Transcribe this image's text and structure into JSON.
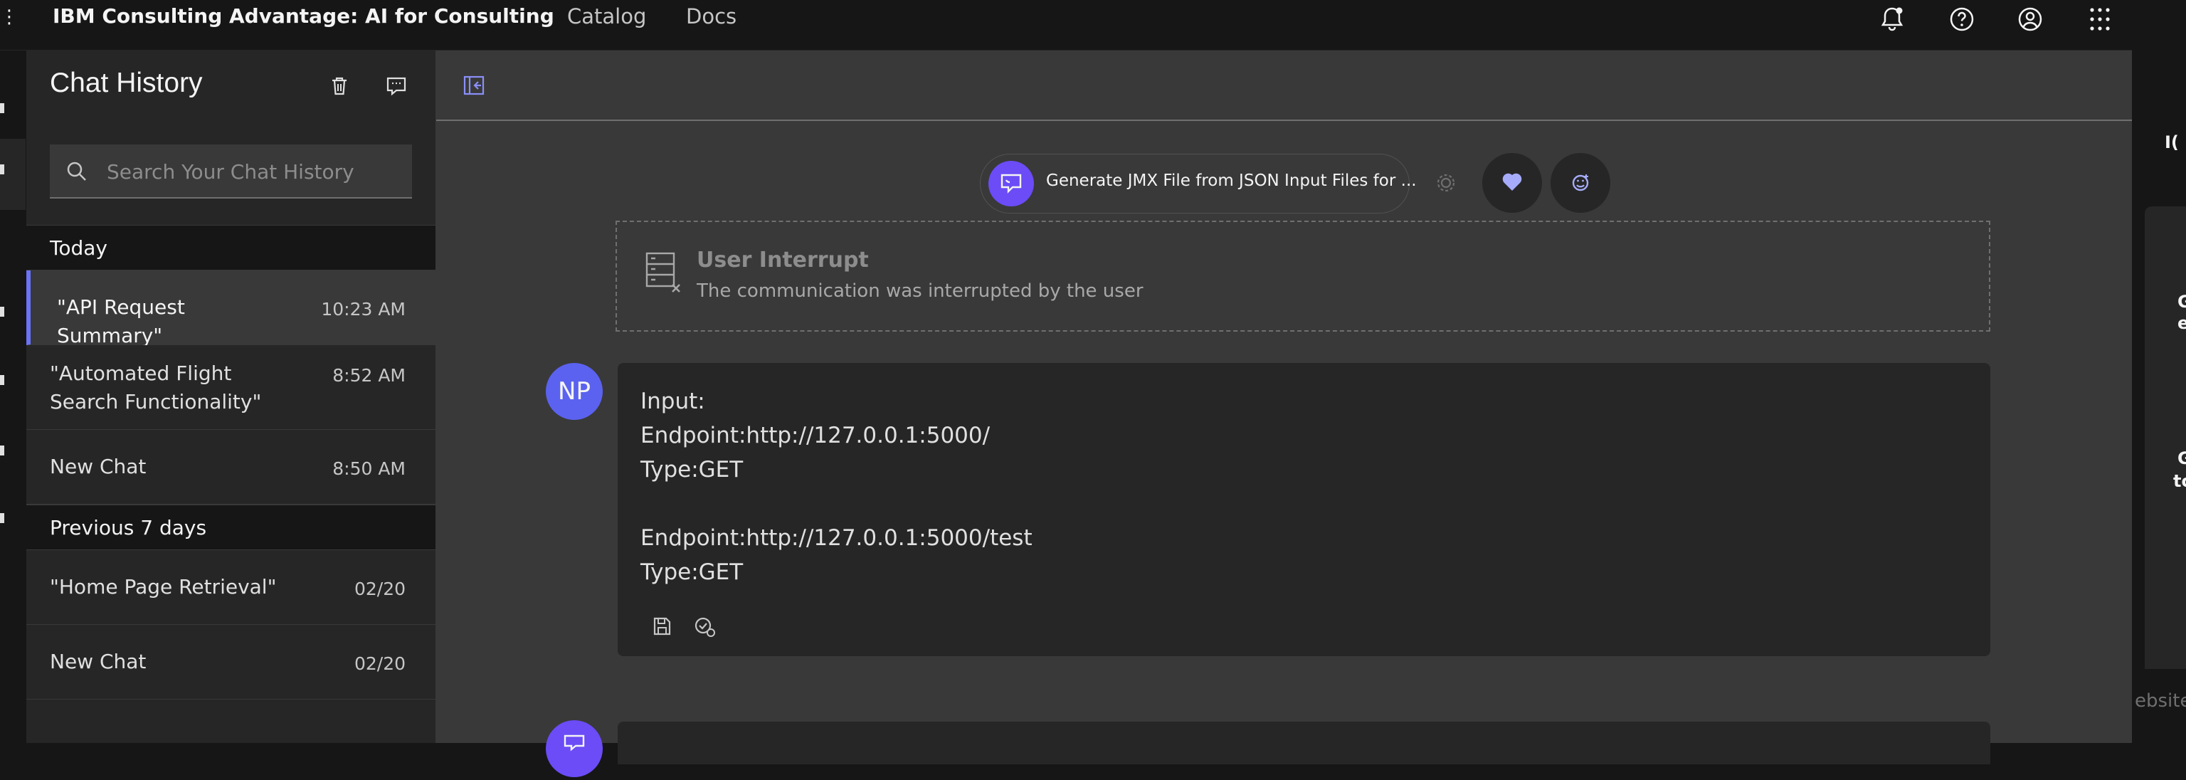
{
  "topbar": {
    "menu_glyph": "⋮",
    "brand": "IBM Consulting Advantage: AI for Consulting",
    "nav": [
      "Catalog",
      "Docs"
    ]
  },
  "sidebar": {
    "title": "Chat History",
    "search_placeholder": "Search Your Chat History",
    "groups": [
      {
        "label": "Today",
        "items": [
          {
            "title": "\"API Request Summary\"",
            "time": "10:23 AM",
            "active": true
          },
          {
            "title": "\"Automated Flight Search Functionality\"",
            "time": "8:52 AM"
          },
          {
            "title": "New Chat",
            "time": "8:50 AM"
          }
        ]
      },
      {
        "label": "Previous 7 days",
        "items": [
          {
            "title": "\"Home Page Retrieval\"",
            "time": "02/20"
          },
          {
            "title": "New Chat",
            "time": "02/20"
          }
        ]
      }
    ]
  },
  "main": {
    "assistant_pill": "Generate JMX File from JSON Input Files for ...",
    "interrupt": {
      "title": "User Interrupt",
      "description": "The communication was interrupted by the user"
    },
    "message": {
      "avatar_initials": "NP",
      "lines": [
        "Input:",
        "Endpoint:http://127.0.0.1:5000/",
        "Type:GET",
        "",
        "Endpoint:http://127.0.0.1:5000/test",
        "Type:GET"
      ]
    }
  },
  "right_edge": {
    "frag_top": "I(",
    "frag_a1": "G",
    "frag_a2": "e",
    "frag_b1": "G",
    "frag_b2": "tc",
    "frag_bottom": "ebsite"
  },
  "colors": {
    "accent": "#6b73f6",
    "avatar": "#5b62f0",
    "assistant": "#6b4cf6"
  }
}
